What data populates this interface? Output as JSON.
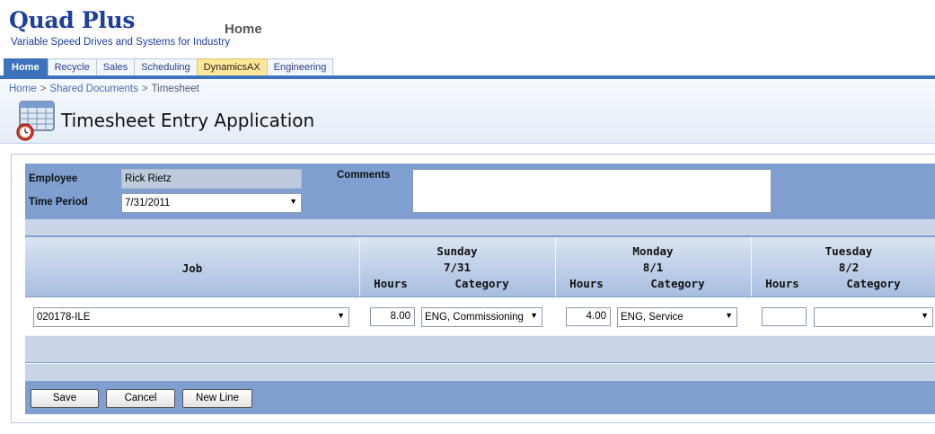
{
  "brand": {
    "title": "Quad Plus",
    "subtitle": "Variable Speed Drives and Systems for Industry"
  },
  "site_title": "Home",
  "tabs": [
    {
      "label": "Home",
      "active": true
    },
    {
      "label": "Recycle"
    },
    {
      "label": "Sales"
    },
    {
      "label": "Scheduling"
    },
    {
      "label": "DynamicsAX",
      "highlighted": true
    },
    {
      "label": "Engineering"
    }
  ],
  "breadcrumb": {
    "items": [
      "Home",
      "Shared Documents",
      "Timesheet"
    ],
    "separator": ">"
  },
  "page_title": "Timesheet Entry Application",
  "page_icon": "timesheet-calendar-clock-icon",
  "form": {
    "employee_label": "Employee",
    "employee_value": "Rick Rietz",
    "time_period_label": "Time Period",
    "time_period_value": "7/31/2011",
    "comments_label": "Comments",
    "comments_value": ""
  },
  "grid": {
    "job_header": "Job",
    "hours_header": "Hours",
    "category_header": "Category",
    "days": [
      {
        "name": "Sunday",
        "date": "7/31"
      },
      {
        "name": "Monday",
        "date": "8/1"
      },
      {
        "name": "Tuesday",
        "date": "8/2"
      }
    ],
    "row": {
      "job": "020178-ILE",
      "entries": [
        {
          "hours": "8.00",
          "category": "ENG, Commissioning"
        },
        {
          "hours": "4.00",
          "category": "ENG, Service"
        },
        {
          "hours": "",
          "category": ""
        }
      ]
    }
  },
  "buttons": {
    "save": "Save",
    "cancel": "Cancel",
    "new_line": "New Line"
  },
  "colors": {
    "brand": "#1f3f9c",
    "accent": "#3d73bc",
    "panel": "#7e9fcf",
    "tab_highlight": "#fde89a"
  }
}
